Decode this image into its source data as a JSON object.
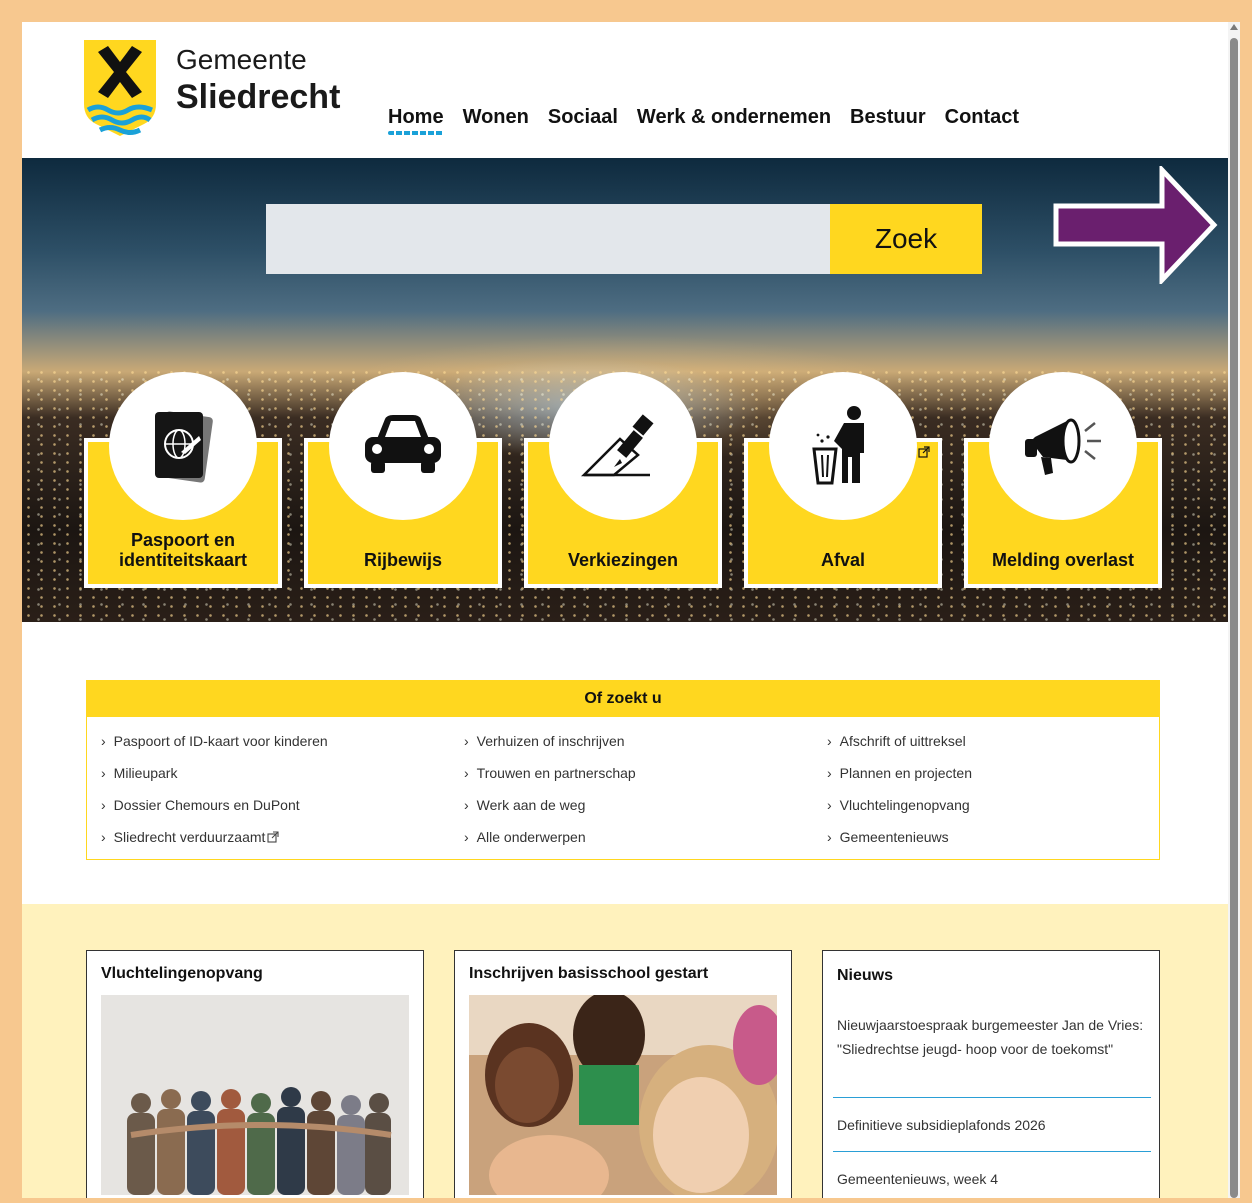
{
  "brand": {
    "line1": "Gemeente",
    "line2": "Sliedrecht"
  },
  "nav": [
    "Home",
    "Wonen",
    "Sociaal",
    "Werk & ondernemen",
    "Bestuur",
    "Contact"
  ],
  "search": {
    "placeholder": "",
    "button": "Zoek"
  },
  "tiles": [
    {
      "label": "Paspoort en identiteitskaart",
      "icon": "passport-icon"
    },
    {
      "label": "Rijbewijs",
      "icon": "car-icon"
    },
    {
      "label": "Verkiezingen",
      "icon": "ballot-icon"
    },
    {
      "label": "Afval",
      "icon": "waste-bin-icon",
      "external": true
    },
    {
      "label": "Melding overlast",
      "icon": "megaphone-icon"
    }
  ],
  "of_zoekt_u": {
    "title": "Of zoekt u",
    "links": [
      "Paspoort of ID-kaart voor kinderen",
      "Verhuizen of inschrijven",
      "Afschrift of uittreksel",
      "Milieupark",
      "Trouwen en partnerschap",
      "Plannen en projecten",
      "Dossier Chemours en DuPont",
      "Werk aan de weg",
      "Vluchtelingenopvang",
      "Sliedrecht verduurzaamt",
      "Alle onderwerpen",
      "Gemeentenieuws"
    ]
  },
  "cards": {
    "card1": {
      "title": "Vluchtelingenopvang"
    },
    "card2": {
      "title": "Inschrijven basisschool gestart"
    },
    "news": {
      "title": "Nieuws",
      "items": [
        "Nieuwjaarstoespraak burgemeester Jan de Vries: \"Sliedrechtse jeugd- hoop voor de toekomst\"",
        "Definitieve subsidieplafonds 2026",
        "Gemeentenieuws, week 4"
      ]
    }
  },
  "colors": {
    "accent": "#ffd71f",
    "frame": "#f7c88f",
    "cream": "#fff2bd",
    "link_blue": "#1aa1d8",
    "arrow": "#6a1f6e"
  }
}
